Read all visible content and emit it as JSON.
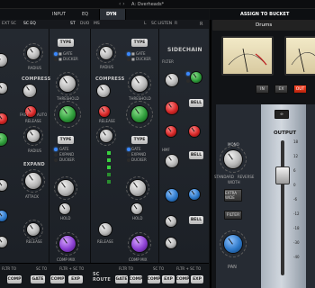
{
  "topbar": {
    "preset": "A: Overheads*",
    "tabs": [
      "INPUT",
      "EQ",
      "DYN"
    ],
    "active_tab": "DYN"
  },
  "subtabs": {
    "left": [
      "EXT SC",
      "SC EQ"
    ],
    "mid": [
      "ST",
      "DUO",
      "MS"
    ],
    "right": [
      "L",
      "SC LISTEN",
      "R"
    ]
  },
  "labels": {
    "type": "TYPE",
    "radius": "RADIUS",
    "compress": "COMPRESS",
    "threshold": "THRESHOLD",
    "release": "RELEASE",
    "fast": "FAST",
    "auto": "AUTO",
    "expand": "EXPAND",
    "gate": "GATE",
    "ducker": "DUCKER",
    "attack": "ATTACK",
    "hold": "HOLD",
    "sidechain": "SIDECHAIN",
    "filter": "FILTER",
    "hmf": "HMF",
    "bell": "BELL",
    "comp": "COMP",
    "exp": "EXP",
    "comp_mix": "COMP MIX",
    "sc_route": "SC ROUTE",
    "peak_meter_label": "LOOK"
  },
  "right_panel": {
    "header": "ASSIGN TO BUCKET",
    "channel_name": "Drums",
    "buttons": [
      "IN",
      "EX",
      "OUT"
    ],
    "output_label": "OUTPUT",
    "mono_label": "MONO",
    "width_label": "WIDTH",
    "standard_label": "STANDARD",
    "reverse_label": "REVERSE",
    "extra_wide": "EXTRA WIDE",
    "filter": "FILTER",
    "pan_label": "PAN",
    "scale": [
      "18",
      "12",
      "6",
      "0",
      "-6",
      "-12",
      "-18",
      "-30",
      "-40"
    ]
  },
  "bottom_left": {
    "filter_labels": [
      "FLTR TO",
      "SC TO",
      "FLTR + SC TO"
    ],
    "route_buttons": [
      "COMP",
      "GATE",
      "COMP",
      "EXP"
    ],
    "bottom_tags": [
      "FLTR TO",
      "SC TO",
      "FLTR + SC TO"
    ]
  }
}
